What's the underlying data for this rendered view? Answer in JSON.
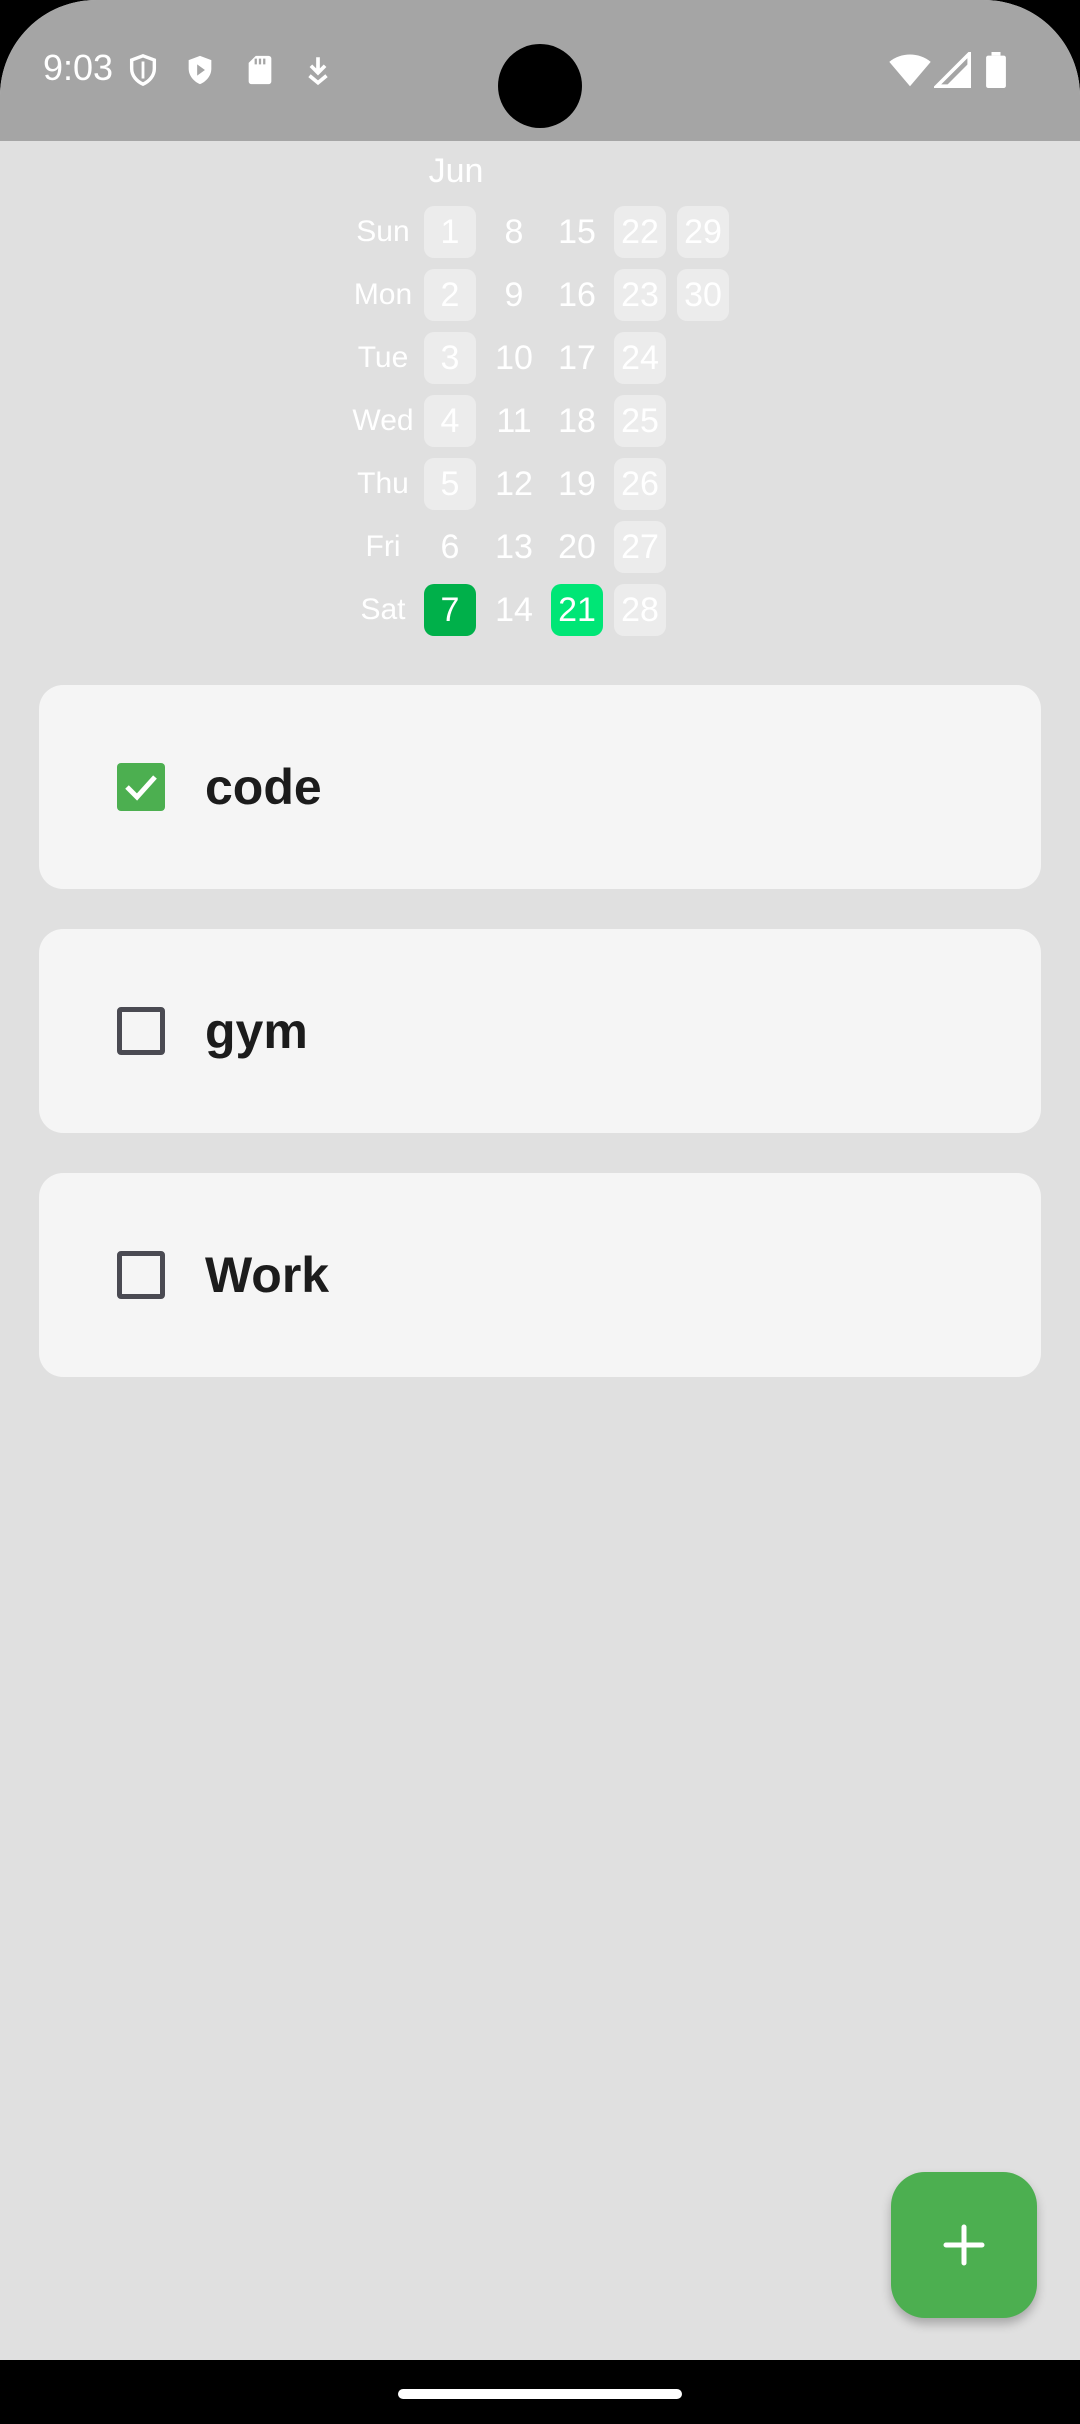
{
  "status_bar": {
    "time": "9:03",
    "left_icons": [
      "shield-outline-icon",
      "play-shield-icon",
      "sd-card-icon",
      "download-icon"
    ],
    "right_icons": [
      "wifi-icon",
      "cell-signal-icon",
      "battery-icon"
    ]
  },
  "heatmap": {
    "month_label": "Jun",
    "weekdays": [
      "Sun",
      "Mon",
      "Tue",
      "Wed",
      "Thu",
      "Fri",
      "Sat"
    ],
    "weeks": [
      [
        {
          "day": "1",
          "state": "highlight"
        },
        {
          "day": "2",
          "state": "highlight"
        },
        {
          "day": "3",
          "state": "highlight"
        },
        {
          "day": "4",
          "state": "highlight"
        },
        {
          "day": "5",
          "state": "highlight"
        },
        {
          "day": "6",
          "state": "none"
        },
        {
          "day": "7",
          "state": "done-dark"
        }
      ],
      [
        {
          "day": "8",
          "state": "none"
        },
        {
          "day": "9",
          "state": "none"
        },
        {
          "day": "10",
          "state": "none"
        },
        {
          "day": "11",
          "state": "none"
        },
        {
          "day": "12",
          "state": "none"
        },
        {
          "day": "13",
          "state": "none"
        },
        {
          "day": "14",
          "state": "none"
        }
      ],
      [
        {
          "day": "15",
          "state": "none"
        },
        {
          "day": "16",
          "state": "none"
        },
        {
          "day": "17",
          "state": "none"
        },
        {
          "day": "18",
          "state": "none"
        },
        {
          "day": "19",
          "state": "none"
        },
        {
          "day": "20",
          "state": "none"
        },
        {
          "day": "21",
          "state": "done-bright"
        }
      ],
      [
        {
          "day": "22",
          "state": "highlight"
        },
        {
          "day": "23",
          "state": "highlight"
        },
        {
          "day": "24",
          "state": "highlight"
        },
        {
          "day": "25",
          "state": "highlight"
        },
        {
          "day": "26",
          "state": "highlight"
        },
        {
          "day": "27",
          "state": "highlight"
        },
        {
          "day": "28",
          "state": "highlight"
        }
      ],
      [
        {
          "day": "29",
          "state": "highlight"
        },
        {
          "day": "30",
          "state": "highlight"
        }
      ]
    ]
  },
  "tasks": [
    {
      "label": "code",
      "checked": true
    },
    {
      "label": "gym",
      "checked": false
    },
    {
      "label": "Work",
      "checked": false
    }
  ],
  "fab": {
    "icon": "plus-icon"
  },
  "colors": {
    "accent": "#4caf50",
    "done_dark": "#00b04a",
    "done_bright": "#00e676",
    "background": "#e0e0e0",
    "card": "#f5f5f5",
    "status_bar": "#a5a5a5"
  }
}
